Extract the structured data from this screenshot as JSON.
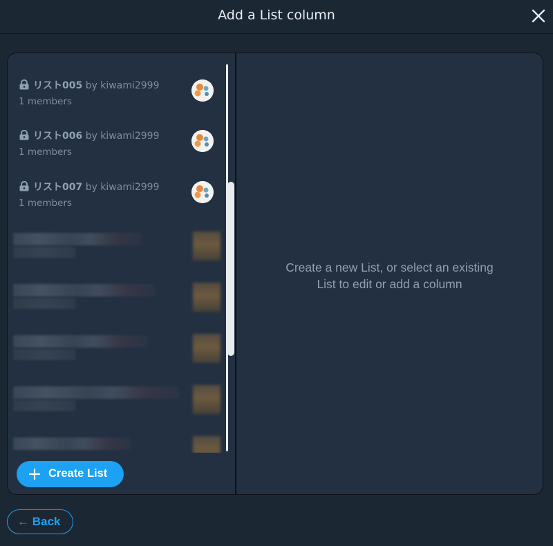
{
  "window": {
    "title": "Add a List column"
  },
  "lists": [
    {
      "name": "リスト005",
      "by": "by kiwami2999",
      "members": "1 members"
    },
    {
      "name": "リスト006",
      "by": "by kiwami2999",
      "members": "1 members"
    },
    {
      "name": "リスト007",
      "by": "by kiwami2999",
      "members": "1 members"
    }
  ],
  "buttons": {
    "create_list": "Create List",
    "back": "← Back"
  },
  "empty_state": {
    "line1": "Create a new List, or select an existing",
    "line2": "List to edit or add a column"
  },
  "icons": {
    "close": "close-icon",
    "lock": "lock-icon",
    "plus": "plus-icon"
  },
  "colors": {
    "accent": "#1da1f2",
    "background": "#1c2734",
    "panel": "#223041"
  }
}
